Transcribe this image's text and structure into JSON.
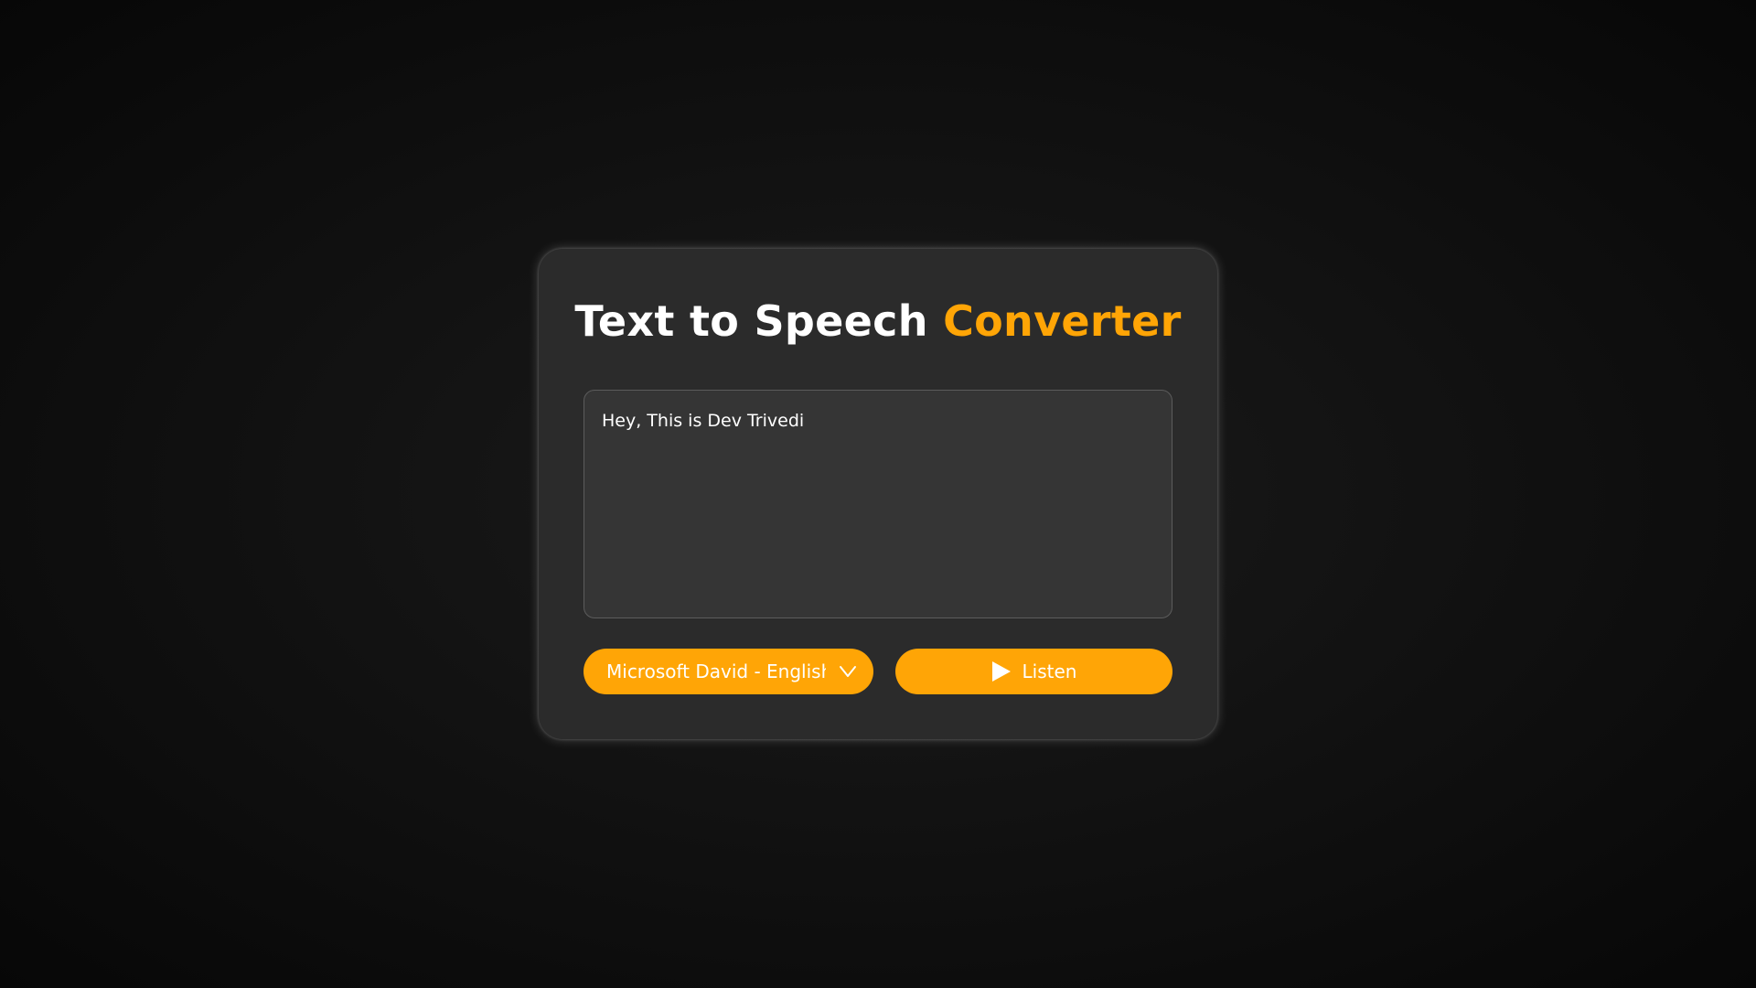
{
  "header": {
    "title_main": "Text to Speech ",
    "title_accent": "Converter"
  },
  "text_input": {
    "value": "Hey, This is Dev Trivedi"
  },
  "voice_select": {
    "selected": "Microsoft David - English"
  },
  "listen_button": {
    "label": "Listen",
    "icon": "play-icon"
  },
  "colors": {
    "accent": "#ffa506",
    "card": "#2b2b2b",
    "textarea": "#353535",
    "background": "#121212"
  }
}
